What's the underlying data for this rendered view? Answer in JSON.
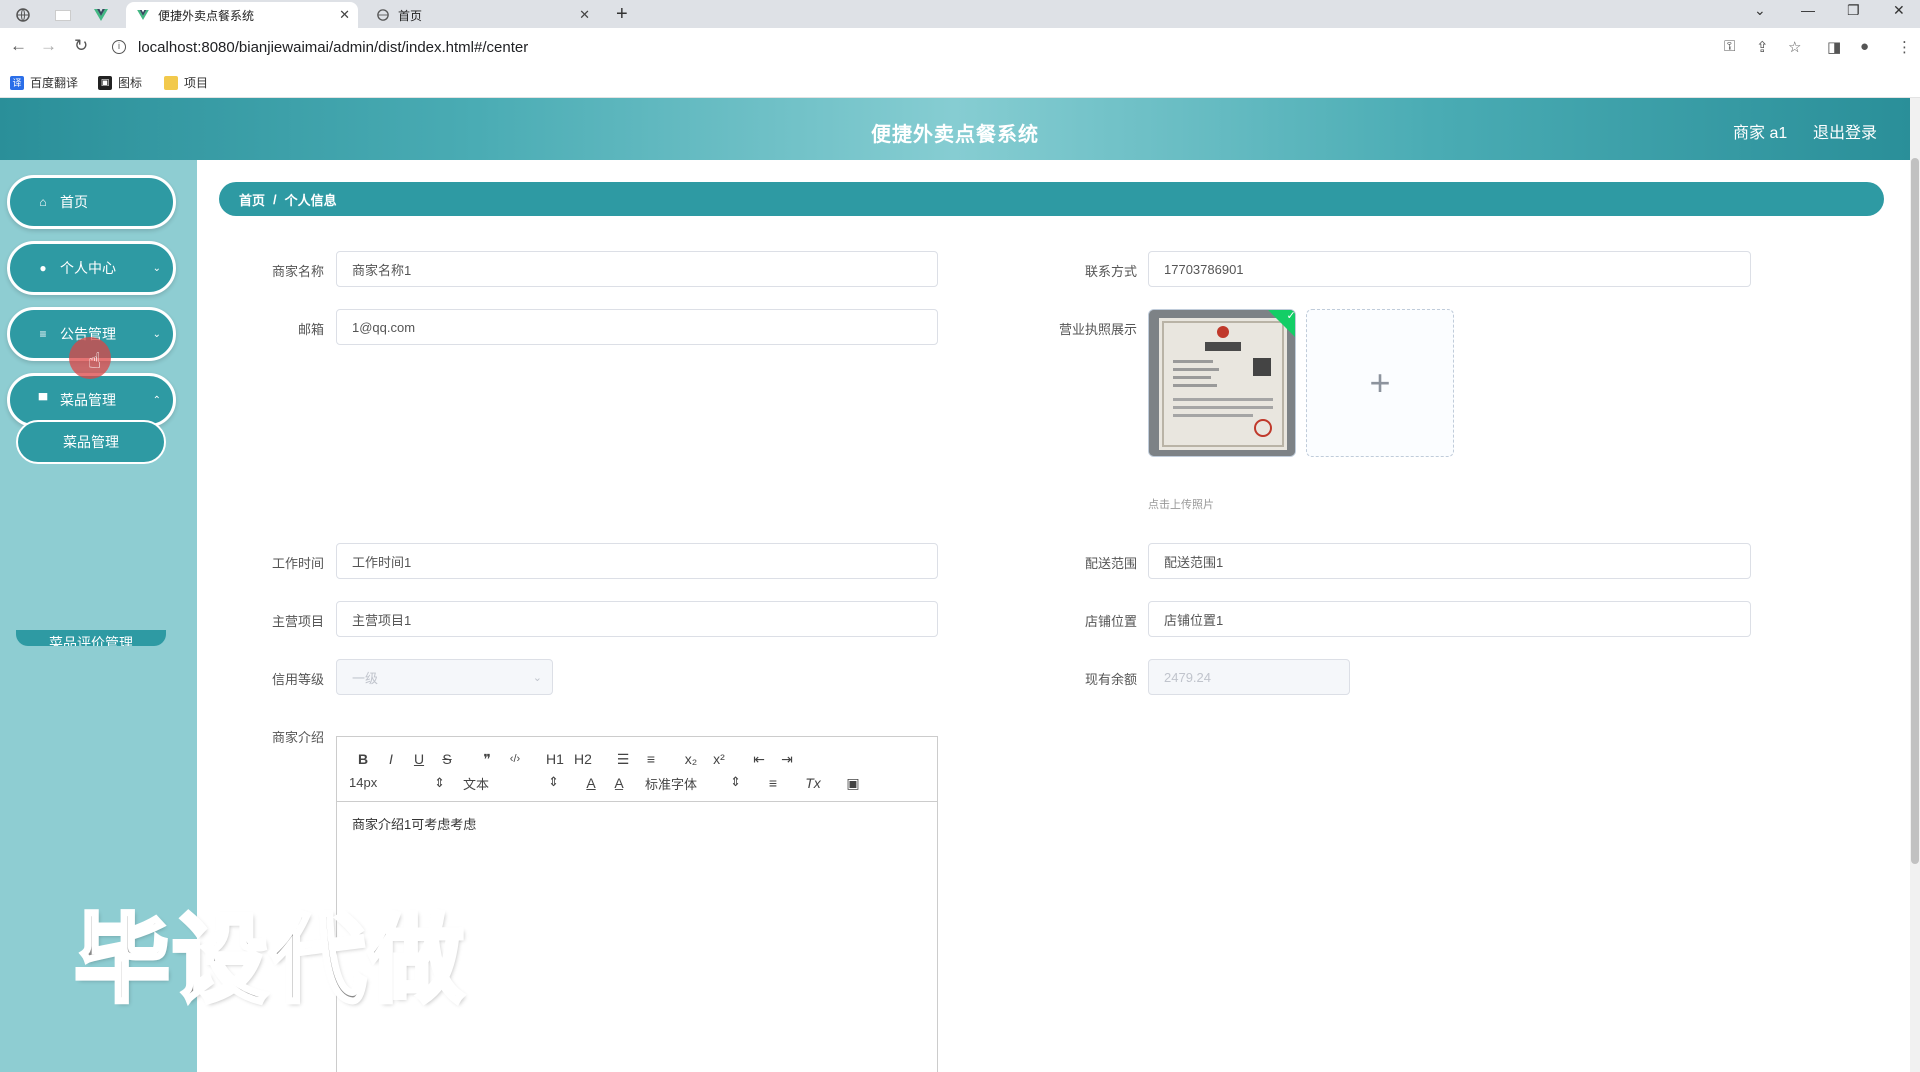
{
  "browser": {
    "tabs": [
      {
        "title": "便捷外卖点餐系统",
        "icon": "vue-icon",
        "active": true
      },
      {
        "title": "首页",
        "icon": "globe-icon",
        "active": false
      }
    ],
    "url": "localhost:8080/bianjiewaimai/admin/dist/index.html#/center",
    "bookmarks": [
      {
        "label": "百度翻译",
        "icon": "translate-icon",
        "color": "#2a6ee8"
      },
      {
        "label": "图标",
        "icon": "image-icon",
        "color": "#222222"
      },
      {
        "label": "项目",
        "icon": "folder-icon",
        "color": "#f2c94c"
      }
    ]
  },
  "header": {
    "title": "便捷外卖点餐系统",
    "user": "商家 a1",
    "logout": "退出登录"
  },
  "sidebar": {
    "items": [
      {
        "label": "首页",
        "icon": "home-icon"
      },
      {
        "label": "个人中心",
        "icon": "user-icon"
      },
      {
        "label": "公告管理",
        "icon": "list-icon"
      },
      {
        "label": "菜品管理",
        "icon": "monitor-icon"
      }
    ],
    "subitems": [
      {
        "label": "菜品管理"
      },
      {
        "label": "菜品评价管理"
      }
    ]
  },
  "breadcrumb": {
    "home": "首页",
    "sep": "/",
    "current": "个人信息"
  },
  "form": {
    "shop_name": {
      "label": "商家名称",
      "value": "商家名称1"
    },
    "contact": {
      "label": "联系方式",
      "value": "17703786901"
    },
    "email": {
      "label": "邮箱",
      "value": "1@qq.com"
    },
    "license": {
      "label": "营业执照展示",
      "tip": "点击上传照片",
      "plus": "+"
    },
    "work_time": {
      "label": "工作时间",
      "value": "工作时间1"
    },
    "delivery_range": {
      "label": "配送范围",
      "value": "配送范围1"
    },
    "main_project": {
      "label": "主营项目",
      "value": "主营项目1"
    },
    "shop_location": {
      "label": "店铺位置",
      "value": "店铺位置1"
    },
    "credit_level": {
      "label": "信用等级",
      "value": "一级"
    },
    "balance": {
      "label": "现有余额",
      "value": "2479.24"
    },
    "intro": {
      "label": "商家介绍",
      "value": "商家介绍1可考虑考虑"
    }
  },
  "editor": {
    "row1": [
      "B",
      "I",
      "U",
      "S",
      "❞",
      "‹/›",
      "H1",
      "H2",
      "☰",
      "≡",
      "x₂",
      "x²",
      "⇤",
      "⇥"
    ],
    "font_size": "14px",
    "format": "文本",
    "font_family": "标准字体",
    "row2_icons": [
      "A",
      "A̲",
      "≡",
      "Tx",
      "▣"
    ]
  },
  "watermark": "毕设代做",
  "colors": {
    "primary": "#2e9aa3",
    "sidebar_bg": "#8ecdd2",
    "success": "#13ce66"
  }
}
